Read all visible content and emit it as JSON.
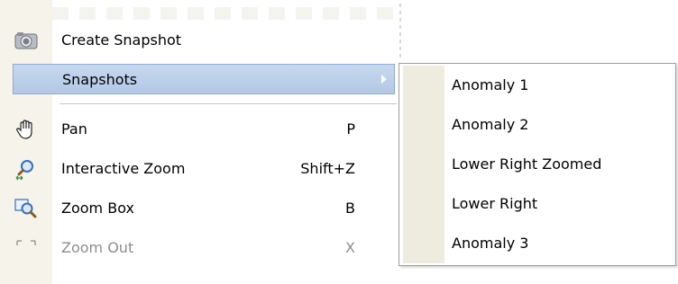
{
  "menu": {
    "items": [
      {
        "label": "Create Snapshot",
        "shortcut": "",
        "icon": "camera-icon"
      },
      {
        "label": "Snapshots",
        "shortcut": "",
        "icon": "",
        "has_submenu": true,
        "highlighted": true
      },
      {
        "label": "Pan",
        "shortcut": "P",
        "icon": "hand-icon"
      },
      {
        "label": "Interactive Zoom",
        "shortcut": "Shift+Z",
        "icon": "magnifier-icon"
      },
      {
        "label": "Zoom Box",
        "shortcut": "B",
        "icon": "zoom-box-icon"
      },
      {
        "label": "Zoom Out",
        "shortcut": "X",
        "icon": "zoom-out-icon"
      }
    ]
  },
  "submenu": {
    "items": [
      "Anomaly 1",
      "Anomaly 2",
      "Lower Right Zoomed",
      "Lower Right",
      "Anomaly 3"
    ]
  },
  "colors": {
    "highlight": "#b9cdea",
    "gutter": "#f5f3ea"
  }
}
